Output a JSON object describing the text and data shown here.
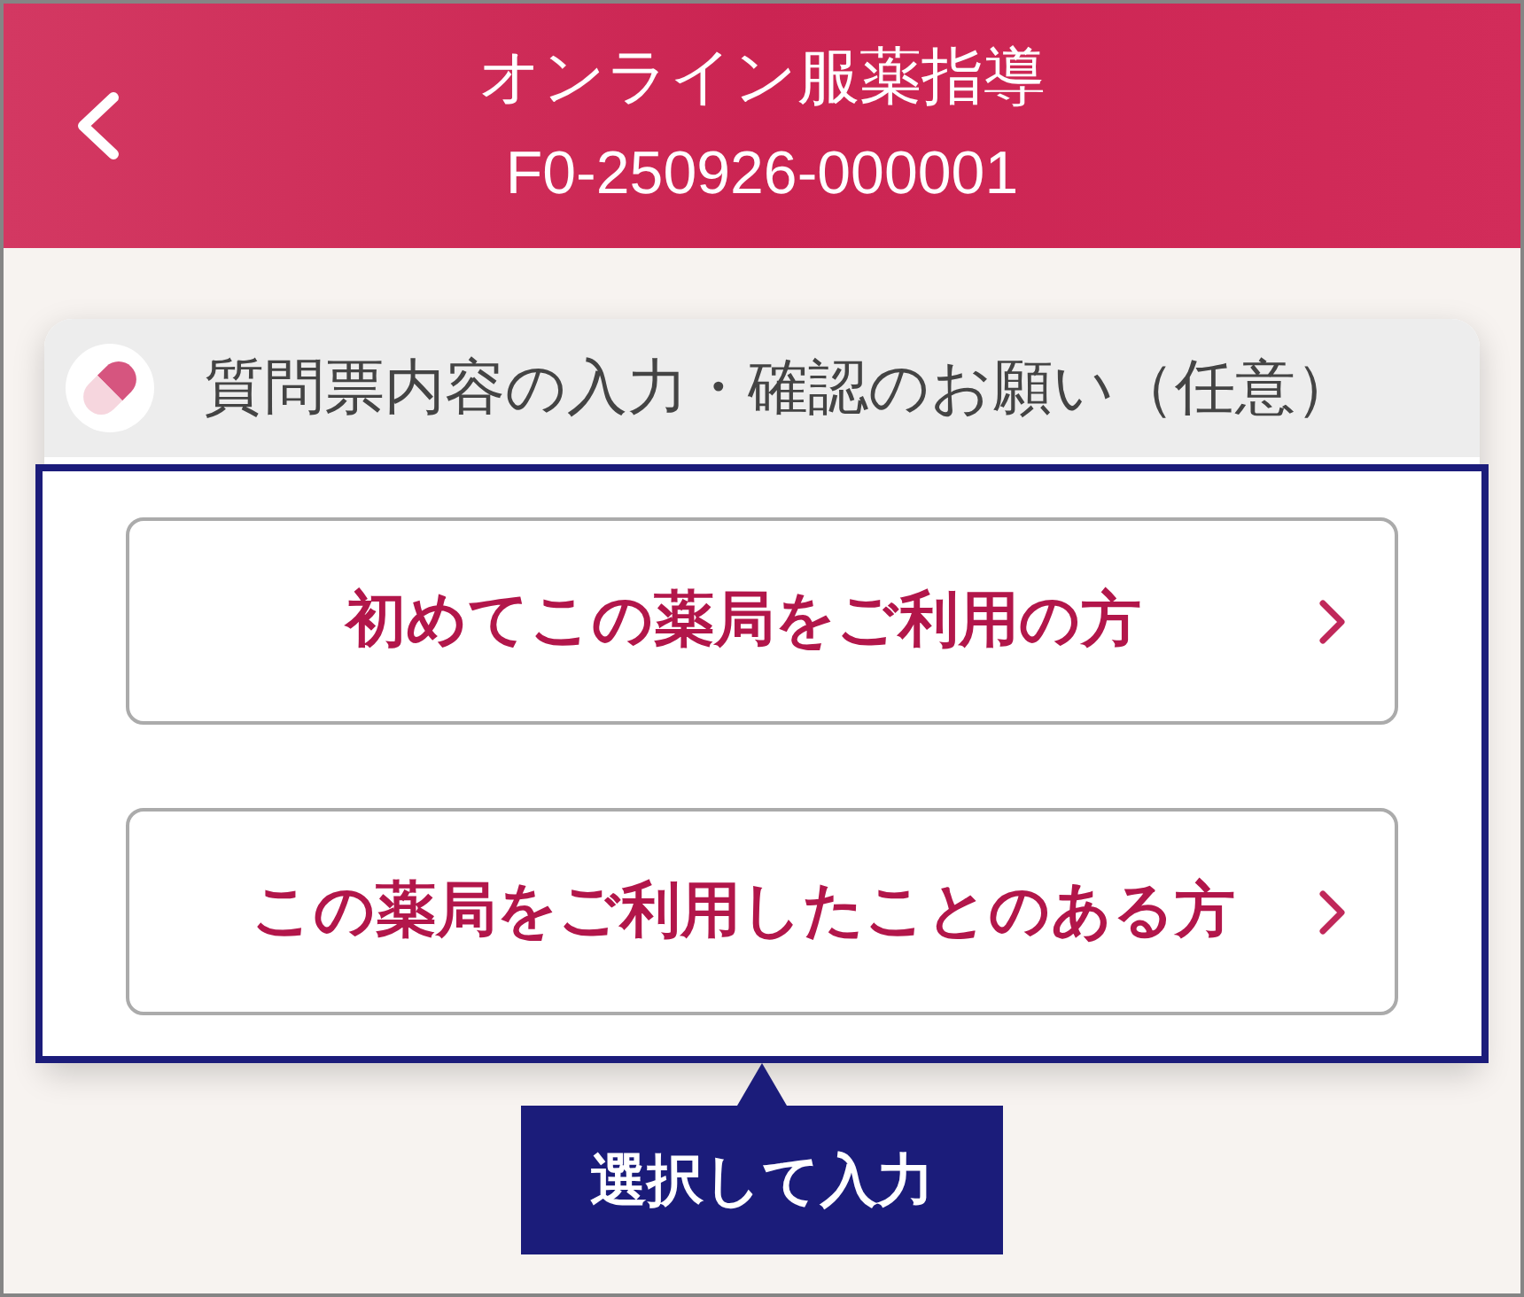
{
  "header": {
    "title": "オンライン服薬指導",
    "subtitle": "F0-250926-000001"
  },
  "card": {
    "title": "質問票内容の入力・確認のお願い（任意）",
    "options": [
      {
        "label": "初めてこの薬局をご利用の方"
      },
      {
        "label": "この薬局をご利用したことのある方"
      }
    ]
  },
  "callout": {
    "label": "選択して入力"
  }
}
